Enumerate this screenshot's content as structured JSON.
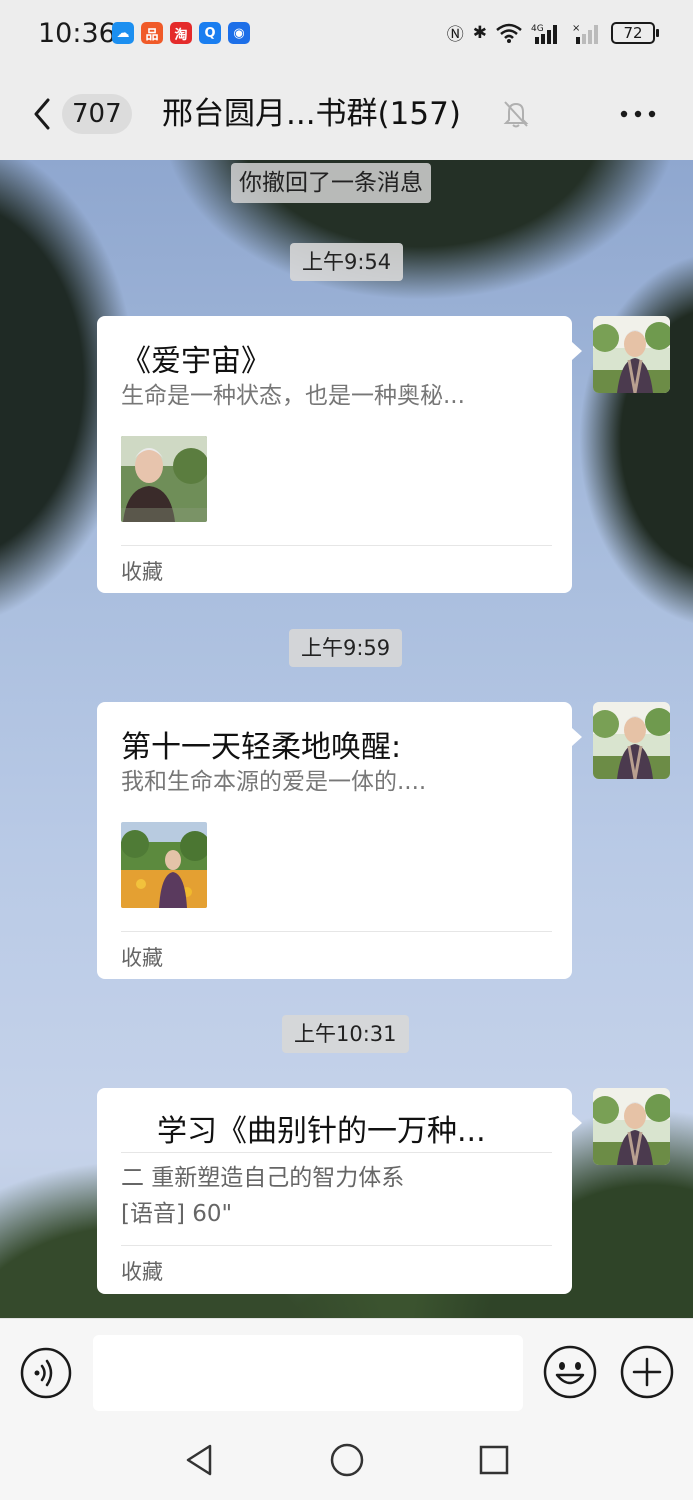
{
  "status_bar": {
    "time": "10:36",
    "battery": "72",
    "network": "4G"
  },
  "header": {
    "unread_count": "707",
    "title": "邢台圆月...书群(157)"
  },
  "messages": {
    "recalled_notice": "你撤回了一条消息",
    "items": [
      {
        "timestamp": "上午9:54",
        "title": "《爱宇宙》",
        "description": "生命是一种状态，也是一种奥秘...",
        "footer": "收藏"
      },
      {
        "timestamp": "上午9:59",
        "title": "第十一天轻柔地唤醒:",
        "description": "我和生命本源的爱是一体的....",
        "footer": "收藏"
      },
      {
        "timestamp": "上午10:31",
        "title": "学习《曲别针的一万种...",
        "description_line1": "二   重新塑造自己的智力体系",
        "description_line2": "[语音] 60\"",
        "footer": "收藏"
      }
    ]
  },
  "input_bar": {
    "placeholder": ""
  },
  "colors": {
    "background": "#ededed",
    "card": "#ffffff",
    "timestamp_bg": "#d7d7d7"
  }
}
